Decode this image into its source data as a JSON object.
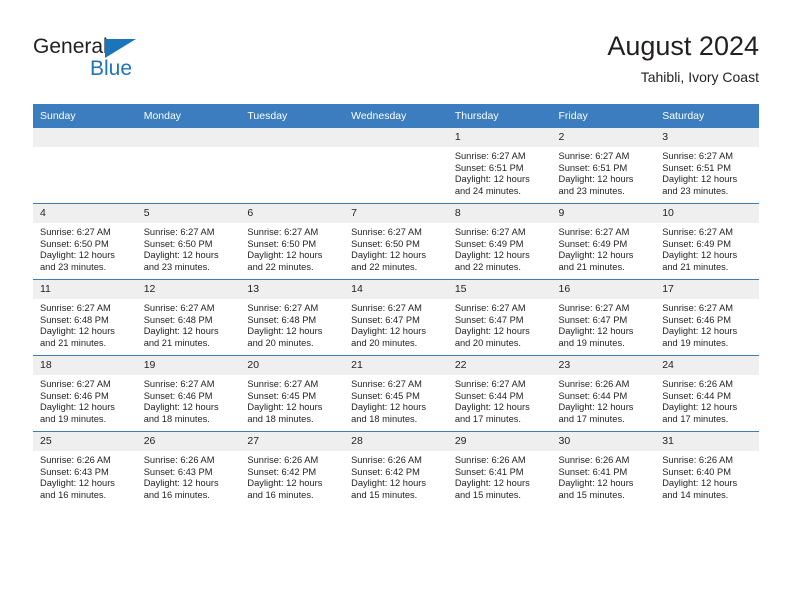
{
  "brand": {
    "line1": "General",
    "line2": "Blue",
    "triangle_color": "#1b75bb"
  },
  "header": {
    "title": "August 2024",
    "location": "Tahibli, Ivory Coast"
  },
  "theme": {
    "header_blue": "#3c7dbf",
    "daynum_gray": "#efefef",
    "text": "#231f20"
  },
  "weekday_headers": [
    "Sunday",
    "Monday",
    "Tuesday",
    "Wednesday",
    "Thursday",
    "Friday",
    "Saturday"
  ],
  "weeks": [
    [
      {
        "day": "",
        "empty": true
      },
      {
        "day": "",
        "empty": true
      },
      {
        "day": "",
        "empty": true
      },
      {
        "day": "",
        "empty": true
      },
      {
        "day": "1",
        "sunrise": "Sunrise: 6:27 AM",
        "sunset": "Sunset: 6:51 PM",
        "daylight": "Daylight: 12 hours and 24 minutes."
      },
      {
        "day": "2",
        "sunrise": "Sunrise: 6:27 AM",
        "sunset": "Sunset: 6:51 PM",
        "daylight": "Daylight: 12 hours and 23 minutes."
      },
      {
        "day": "3",
        "sunrise": "Sunrise: 6:27 AM",
        "sunset": "Sunset: 6:51 PM",
        "daylight": "Daylight: 12 hours and 23 minutes."
      }
    ],
    [
      {
        "day": "4",
        "sunrise": "Sunrise: 6:27 AM",
        "sunset": "Sunset: 6:50 PM",
        "daylight": "Daylight: 12 hours and 23 minutes."
      },
      {
        "day": "5",
        "sunrise": "Sunrise: 6:27 AM",
        "sunset": "Sunset: 6:50 PM",
        "daylight": "Daylight: 12 hours and 23 minutes."
      },
      {
        "day": "6",
        "sunrise": "Sunrise: 6:27 AM",
        "sunset": "Sunset: 6:50 PM",
        "daylight": "Daylight: 12 hours and 22 minutes."
      },
      {
        "day": "7",
        "sunrise": "Sunrise: 6:27 AM",
        "sunset": "Sunset: 6:50 PM",
        "daylight": "Daylight: 12 hours and 22 minutes."
      },
      {
        "day": "8",
        "sunrise": "Sunrise: 6:27 AM",
        "sunset": "Sunset: 6:49 PM",
        "daylight": "Daylight: 12 hours and 22 minutes."
      },
      {
        "day": "9",
        "sunrise": "Sunrise: 6:27 AM",
        "sunset": "Sunset: 6:49 PM",
        "daylight": "Daylight: 12 hours and 21 minutes."
      },
      {
        "day": "10",
        "sunrise": "Sunrise: 6:27 AM",
        "sunset": "Sunset: 6:49 PM",
        "daylight": "Daylight: 12 hours and 21 minutes."
      }
    ],
    [
      {
        "day": "11",
        "sunrise": "Sunrise: 6:27 AM",
        "sunset": "Sunset: 6:48 PM",
        "daylight": "Daylight: 12 hours and 21 minutes."
      },
      {
        "day": "12",
        "sunrise": "Sunrise: 6:27 AM",
        "sunset": "Sunset: 6:48 PM",
        "daylight": "Daylight: 12 hours and 21 minutes."
      },
      {
        "day": "13",
        "sunrise": "Sunrise: 6:27 AM",
        "sunset": "Sunset: 6:48 PM",
        "daylight": "Daylight: 12 hours and 20 minutes."
      },
      {
        "day": "14",
        "sunrise": "Sunrise: 6:27 AM",
        "sunset": "Sunset: 6:47 PM",
        "daylight": "Daylight: 12 hours and 20 minutes."
      },
      {
        "day": "15",
        "sunrise": "Sunrise: 6:27 AM",
        "sunset": "Sunset: 6:47 PM",
        "daylight": "Daylight: 12 hours and 20 minutes."
      },
      {
        "day": "16",
        "sunrise": "Sunrise: 6:27 AM",
        "sunset": "Sunset: 6:47 PM",
        "daylight": "Daylight: 12 hours and 19 minutes."
      },
      {
        "day": "17",
        "sunrise": "Sunrise: 6:27 AM",
        "sunset": "Sunset: 6:46 PM",
        "daylight": "Daylight: 12 hours and 19 minutes."
      }
    ],
    [
      {
        "day": "18",
        "sunrise": "Sunrise: 6:27 AM",
        "sunset": "Sunset: 6:46 PM",
        "daylight": "Daylight: 12 hours and 19 minutes."
      },
      {
        "day": "19",
        "sunrise": "Sunrise: 6:27 AM",
        "sunset": "Sunset: 6:46 PM",
        "daylight": "Daylight: 12 hours and 18 minutes."
      },
      {
        "day": "20",
        "sunrise": "Sunrise: 6:27 AM",
        "sunset": "Sunset: 6:45 PM",
        "daylight": "Daylight: 12 hours and 18 minutes."
      },
      {
        "day": "21",
        "sunrise": "Sunrise: 6:27 AM",
        "sunset": "Sunset: 6:45 PM",
        "daylight": "Daylight: 12 hours and 18 minutes."
      },
      {
        "day": "22",
        "sunrise": "Sunrise: 6:27 AM",
        "sunset": "Sunset: 6:44 PM",
        "daylight": "Daylight: 12 hours and 17 minutes."
      },
      {
        "day": "23",
        "sunrise": "Sunrise: 6:26 AM",
        "sunset": "Sunset: 6:44 PM",
        "daylight": "Daylight: 12 hours and 17 minutes."
      },
      {
        "day": "24",
        "sunrise": "Sunrise: 6:26 AM",
        "sunset": "Sunset: 6:44 PM",
        "daylight": "Daylight: 12 hours and 17 minutes."
      }
    ],
    [
      {
        "day": "25",
        "sunrise": "Sunrise: 6:26 AM",
        "sunset": "Sunset: 6:43 PM",
        "daylight": "Daylight: 12 hours and 16 minutes."
      },
      {
        "day": "26",
        "sunrise": "Sunrise: 6:26 AM",
        "sunset": "Sunset: 6:43 PM",
        "daylight": "Daylight: 12 hours and 16 minutes."
      },
      {
        "day": "27",
        "sunrise": "Sunrise: 6:26 AM",
        "sunset": "Sunset: 6:42 PM",
        "daylight": "Daylight: 12 hours and 16 minutes."
      },
      {
        "day": "28",
        "sunrise": "Sunrise: 6:26 AM",
        "sunset": "Sunset: 6:42 PM",
        "daylight": "Daylight: 12 hours and 15 minutes."
      },
      {
        "day": "29",
        "sunrise": "Sunrise: 6:26 AM",
        "sunset": "Sunset: 6:41 PM",
        "daylight": "Daylight: 12 hours and 15 minutes."
      },
      {
        "day": "30",
        "sunrise": "Sunrise: 6:26 AM",
        "sunset": "Sunset: 6:41 PM",
        "daylight": "Daylight: 12 hours and 15 minutes."
      },
      {
        "day": "31",
        "sunrise": "Sunrise: 6:26 AM",
        "sunset": "Sunset: 6:40 PM",
        "daylight": "Daylight: 12 hours and 14 minutes."
      }
    ]
  ]
}
